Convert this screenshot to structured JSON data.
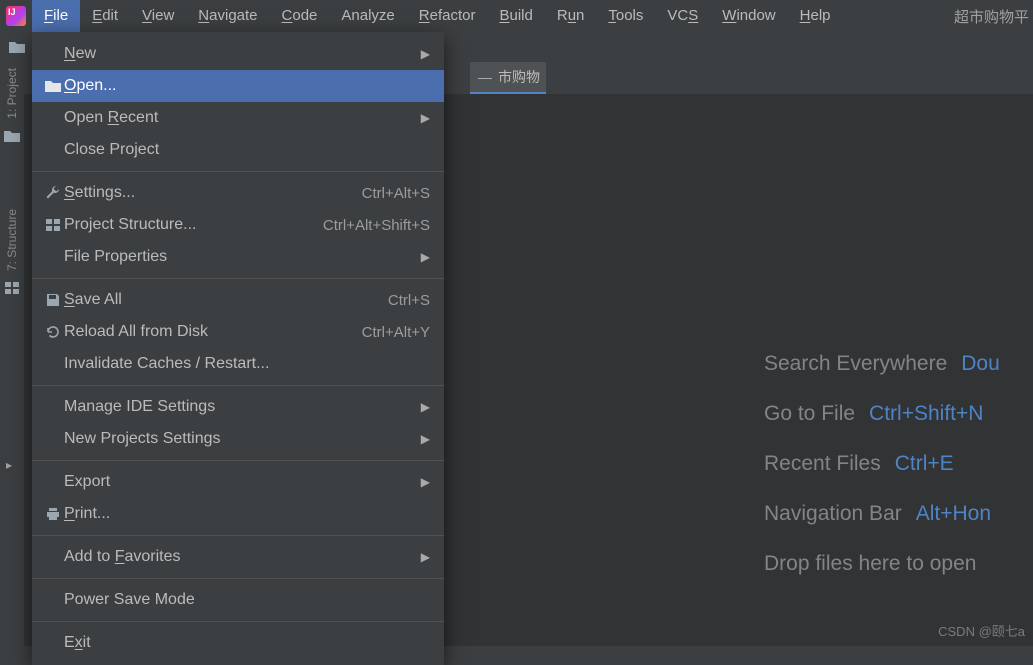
{
  "menubar": {
    "items": [
      {
        "label": "File",
        "hotkey": "F"
      },
      {
        "label": "Edit",
        "hotkey": "E"
      },
      {
        "label": "View",
        "hotkey": "V"
      },
      {
        "label": "Navigate",
        "hotkey": "N"
      },
      {
        "label": "Code",
        "hotkey": "C"
      },
      {
        "label": "Analyze",
        "hotkey": ""
      },
      {
        "label": "Refactor",
        "hotkey": "R"
      },
      {
        "label": "Build",
        "hotkey": "B"
      },
      {
        "label": "Run",
        "hotkey": "u"
      },
      {
        "label": "Tools",
        "hotkey": "T"
      },
      {
        "label": "VCS",
        "hotkey": "S"
      },
      {
        "label": "Window",
        "hotkey": "W"
      },
      {
        "label": "Help",
        "hotkey": "H"
      }
    ],
    "right_text": "超市购物平"
  },
  "dropdown": {
    "groups": [
      [
        {
          "label": "New",
          "hotkey": "N",
          "submenu": true
        },
        {
          "label": "Open...",
          "hotkey": "O",
          "icon": "folder",
          "highlight": true
        },
        {
          "label": "Open Recent",
          "hotkey": "R",
          "submenu": true
        },
        {
          "label": "Close Project"
        }
      ],
      [
        {
          "label": "Settings...",
          "hotkey": "S",
          "icon": "wrench",
          "shortcut": "Ctrl+Alt+S"
        },
        {
          "label": "Project Structure...",
          "icon": "structure",
          "shortcut": "Ctrl+Alt+Shift+S"
        },
        {
          "label": "File Properties",
          "submenu": true
        }
      ],
      [
        {
          "label": "Save All",
          "hotkey": "S",
          "icon": "save",
          "shortcut": "Ctrl+S"
        },
        {
          "label": "Reload All from Disk",
          "icon": "reload",
          "shortcut": "Ctrl+Alt+Y"
        },
        {
          "label": "Invalidate Caches / Restart..."
        }
      ],
      [
        {
          "label": "Manage IDE Settings",
          "submenu": true
        },
        {
          "label": "New Projects Settings",
          "submenu": true
        }
      ],
      [
        {
          "label": "Export",
          "submenu": true
        },
        {
          "label": "Print...",
          "hotkey": "P",
          "icon": "print"
        }
      ],
      [
        {
          "label": "Add to Favorites",
          "hotkey": "F",
          "submenu": true
        }
      ],
      [
        {
          "label": "Power Save Mode"
        }
      ],
      [
        {
          "label": "Exit",
          "hotkey": "x"
        }
      ]
    ]
  },
  "left_stripe": {
    "items": [
      {
        "label": "1: Project",
        "icon": "folder"
      },
      {
        "label": "7: Structure",
        "icon": "structure"
      }
    ]
  },
  "tab": {
    "label": "市购物",
    "minimize": "—"
  },
  "hints": [
    {
      "label": "Search Everywhere",
      "shortcut": "Dou"
    },
    {
      "label": "Go to File",
      "shortcut": "Ctrl+Shift+N"
    },
    {
      "label": "Recent Files",
      "shortcut": "Ctrl+E"
    },
    {
      "label": "Navigation Bar",
      "shortcut": "Alt+Hon"
    },
    {
      "label": "Drop files here to open",
      "shortcut": ""
    }
  ],
  "watermark": "CSDN @颐七a"
}
